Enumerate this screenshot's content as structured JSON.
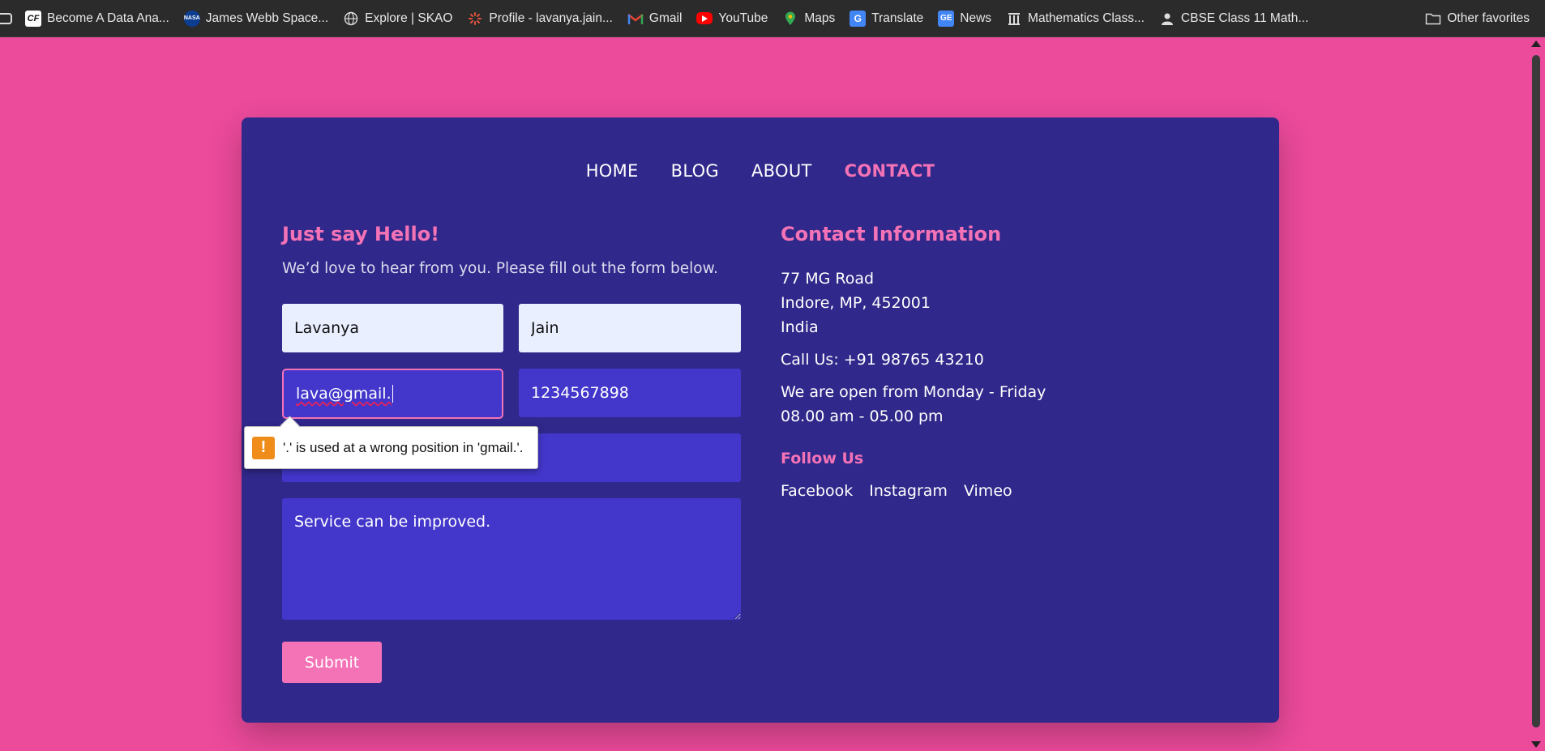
{
  "bookmarks": {
    "items": [
      {
        "label": "Become A Data Ana...",
        "icon": "cf-icon",
        "color": "#ffffff"
      },
      {
        "label": "James Webb Space...",
        "icon": "nasa-icon",
        "color": "#0b3d91"
      },
      {
        "label": "Explore | SKAO",
        "icon": "globe-icon",
        "color": "#888888"
      },
      {
        "label": "Profile - lavanya.jain...",
        "icon": "sparkle-icon",
        "color": "#e0533c"
      },
      {
        "label": "Gmail",
        "icon": "gmail-icon",
        "color": "#ea4335"
      },
      {
        "label": "YouTube",
        "icon": "youtube-icon",
        "color": "#ff0000"
      },
      {
        "label": "Maps",
        "icon": "maps-icon",
        "color": "#34a853"
      },
      {
        "label": "Translate",
        "icon": "translate-icon",
        "color": "#4285f4"
      },
      {
        "label": "News",
        "icon": "news-icon",
        "color": "#4285f4"
      },
      {
        "label": "Mathematics Class...",
        "icon": "building-icon",
        "color": "#dddddd"
      },
      {
        "label": "CBSE Class 11 Math...",
        "icon": "person-icon",
        "color": "#dddddd"
      }
    ],
    "other": "Other favorites"
  },
  "nav": {
    "home": "HOME",
    "blog": "BLOG",
    "about": "ABOUT",
    "contact": "CONTACT"
  },
  "form": {
    "heading": "Just say Hello!",
    "subtext": "We’d love to hear from you. Please fill out the form below.",
    "first_name": "Lavanya",
    "last_name": "Jain",
    "email": "lava@gmail.",
    "phone": "1234567898",
    "subject": "",
    "message": "Service can be improved.",
    "submit_label": "Submit",
    "validation_message": "'.' is used at a wrong position in 'gmail.'."
  },
  "contact": {
    "heading": "Contact Information",
    "address_line1": "77 MG Road",
    "address_line2": "Indore, MP, 452001",
    "address_line3": "India",
    "call": "Call Us: +91 98765 43210",
    "hours_line1": "We are open from Monday - Friday",
    "hours_line2": "08.00 am - 05.00 pm",
    "follow_heading": "Follow Us",
    "socials": [
      "Facebook",
      "Instagram",
      "Vimeo"
    ]
  },
  "colors": {
    "page_bg": "#ec4a9b",
    "card_bg": "#30288a",
    "accent": "#f472b6",
    "input_dark": "#4336cb",
    "input_light": "#e9efff"
  }
}
